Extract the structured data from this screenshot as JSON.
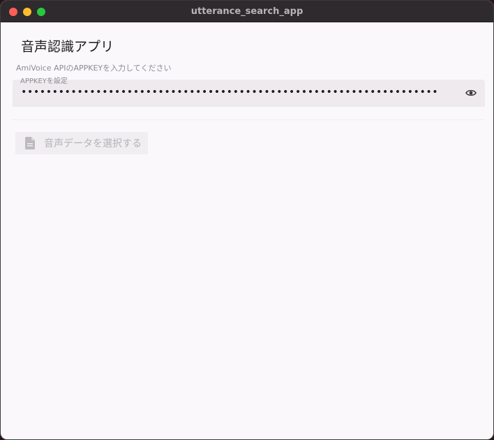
{
  "window": {
    "title": "utterance_search_app"
  },
  "app": {
    "title": "音声認識アプリ",
    "hint": "AmiVoice APIのAPPKEYを入力してください"
  },
  "appkey_field": {
    "label": "APPKEYを設定",
    "value": "•••••••••••••••••••••••••••••••••••••••••••••••••••••••••••••••••••",
    "toggle_icon": "eye-icon"
  },
  "select_audio": {
    "label": "音声データを選択する",
    "icon": "file-icon",
    "state": "disabled"
  },
  "colors": {
    "background": "#fbf8fc",
    "text": "#1d1b1e",
    "hint": "#8d8991",
    "disabled_text": "#b5b1b7"
  }
}
